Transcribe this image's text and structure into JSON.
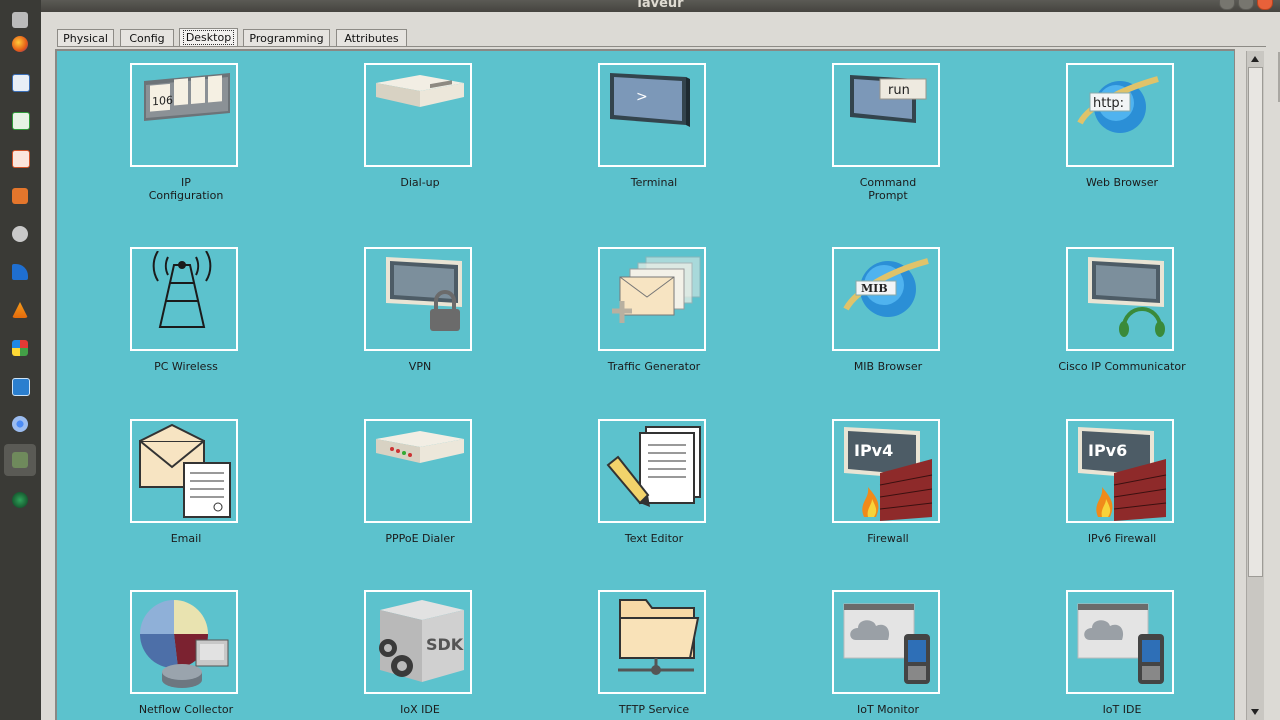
{
  "window": {
    "title": "laveur"
  },
  "tabs": [
    {
      "label": "Physical"
    },
    {
      "label": "Config"
    },
    {
      "label": "Desktop"
    },
    {
      "label": "Programming"
    },
    {
      "label": "Attributes"
    }
  ],
  "active_tab": "Desktop",
  "apps": [
    {
      "label": "IP\nConfiguration",
      "icon": "ip-configuration-icon"
    },
    {
      "label": "Dial-up",
      "icon": "modem-icon"
    },
    {
      "label": "Terminal",
      "icon": "terminal-icon"
    },
    {
      "label": "Command\nPrompt",
      "icon": "command-prompt-icon"
    },
    {
      "label": "Web Browser",
      "icon": "web-browser-icon"
    },
    {
      "label": "PC Wireless",
      "icon": "wireless-antenna-icon"
    },
    {
      "label": "VPN",
      "icon": "vpn-lock-icon"
    },
    {
      "label": "Traffic Generator",
      "icon": "envelopes-icon"
    },
    {
      "label": "MIB Browser",
      "icon": "mib-globe-icon"
    },
    {
      "label": "Cisco IP Communicator",
      "icon": "headset-monitor-icon"
    },
    {
      "label": "Email",
      "icon": "email-icon"
    },
    {
      "label": "PPPoE Dialer",
      "icon": "pppoe-modem-icon"
    },
    {
      "label": "Text Editor",
      "icon": "text-editor-icon"
    },
    {
      "label": "Firewall",
      "icon": "ipv4-firewall-icon"
    },
    {
      "label": "IPv6 Firewall",
      "icon": "ipv6-firewall-icon"
    },
    {
      "label": "Netflow Collector",
      "icon": "pie-chart-router-icon"
    },
    {
      "label": "IoX IDE",
      "icon": "sdk-box-icon"
    },
    {
      "label": "TFTP Service",
      "icon": "folder-network-icon"
    },
    {
      "label": "IoT Monitor",
      "icon": "cloud-phone-icon"
    },
    {
      "label": "IoT IDE",
      "icon": "cloud-phone-ide-icon"
    }
  ],
  "icon_text": {
    "ip": "106",
    "terminal": ">",
    "cmd": "run",
    "browser": "http:",
    "mib": "MIB",
    "ipv4": "IPv4",
    "ipv6": "IPv6",
    "sdk": "SDK"
  },
  "colors": {
    "desktop_bg": "#5cc2cd",
    "tile_border": "#ffffff",
    "close_button": "#e8613a"
  }
}
